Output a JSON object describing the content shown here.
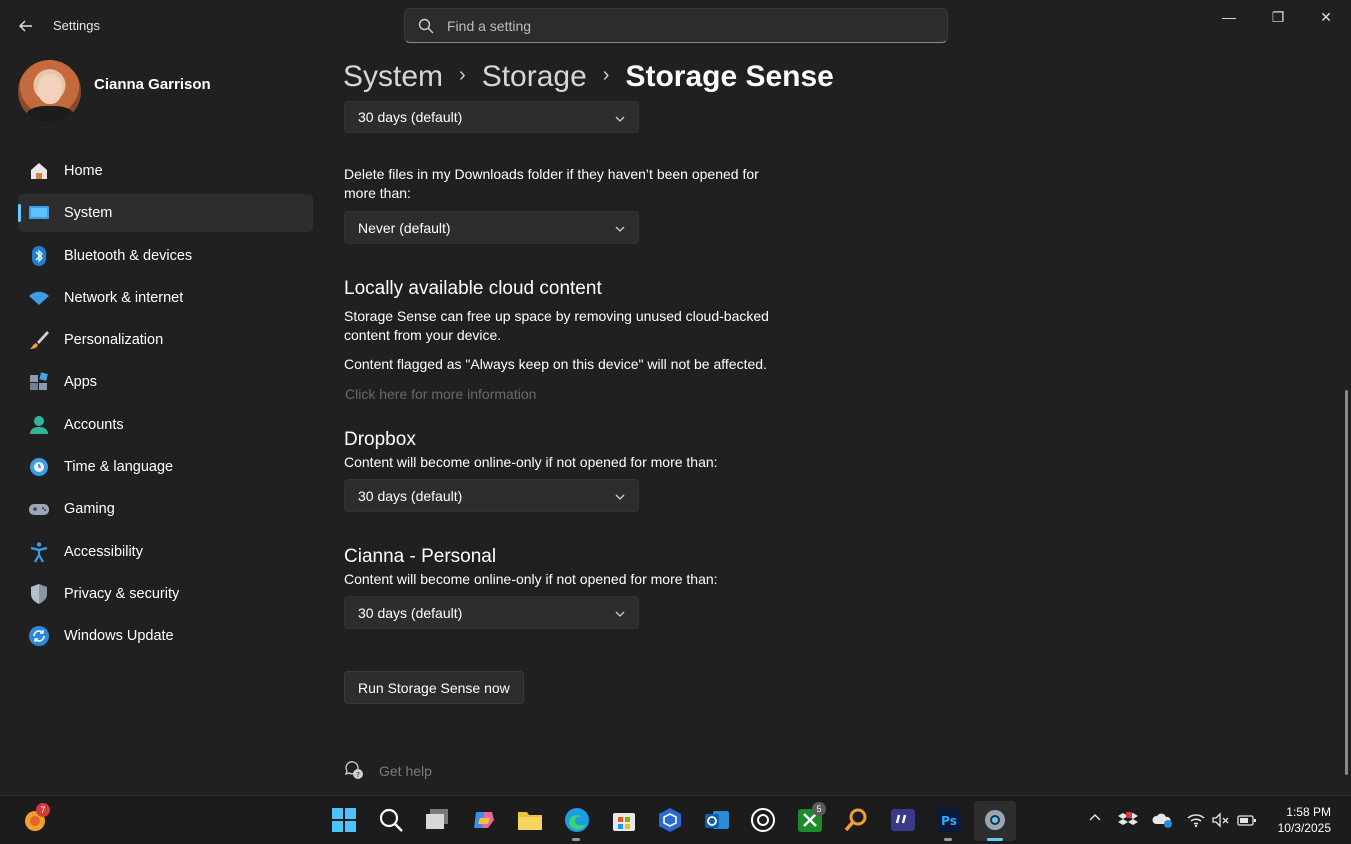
{
  "window": {
    "app_title": "Settings",
    "minimize": "—",
    "restore": "❐",
    "close": "✕"
  },
  "search": {
    "placeholder": "Find a setting"
  },
  "profile": {
    "name": "Cianna Garrison"
  },
  "sidebar": {
    "items": [
      {
        "label": "Home",
        "icon": "home-icon"
      },
      {
        "label": "System",
        "icon": "system-icon",
        "selected": true
      },
      {
        "label": "Bluetooth & devices",
        "icon": "bluetooth-icon"
      },
      {
        "label": "Network & internet",
        "icon": "wifi-icon"
      },
      {
        "label": "Personalization",
        "icon": "brush-icon"
      },
      {
        "label": "Apps",
        "icon": "apps-icon"
      },
      {
        "label": "Accounts",
        "icon": "accounts-icon"
      },
      {
        "label": "Time & language",
        "icon": "globe-clock-icon"
      },
      {
        "label": "Gaming",
        "icon": "gamepad-icon"
      },
      {
        "label": "Accessibility",
        "icon": "accessibility-icon"
      },
      {
        "label": "Privacy & security",
        "icon": "shield-icon"
      },
      {
        "label": "Windows Update",
        "icon": "update-icon"
      }
    ]
  },
  "breadcrumb": {
    "items": [
      "System",
      "Storage",
      "Storage Sense"
    ],
    "separator": "›"
  },
  "content": {
    "recycle_dropdown": "30 days (default)",
    "downloads_label": "Delete files in my Downloads folder if they haven’t been opened for more than:",
    "downloads_dropdown": "Never (default)",
    "cloud_heading": "Locally available cloud content",
    "cloud_desc": "Storage Sense can free up space by removing unused cloud-backed content from your device.",
    "cloud_note": "Content flagged as \"Always keep on this device\" will not be affected.",
    "more_info_link": "Click here for more information",
    "dropbox_heading": "Dropbox",
    "dropbox_desc": "Content will become online-only if not opened for more than:",
    "dropbox_dropdown": "30 days (default)",
    "personal_heading": "Cianna - Personal",
    "personal_desc": "Content will become online-only if not opened for more than:",
    "personal_dropdown": "30 days (default)",
    "run_button": "Run Storage Sense now",
    "get_help": "Get help"
  },
  "taskbar": {
    "notification_count": "7",
    "xbox_badge": "5",
    "time": "1:58 PM",
    "date": "10/3/2025"
  },
  "colors": {
    "accent": "#60cdff",
    "background": "#202020",
    "card": "#2d2d2d",
    "taskbar": "#1c1c1c"
  }
}
